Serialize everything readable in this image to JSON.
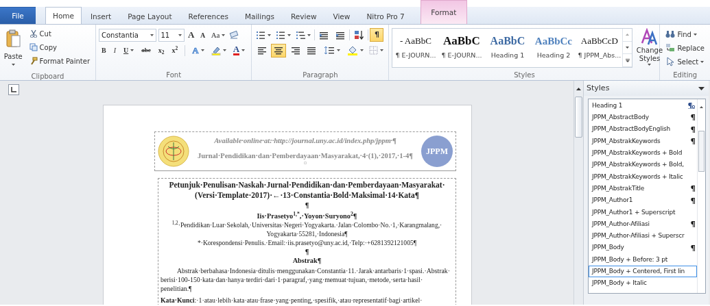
{
  "tabs": [
    {
      "label": "File",
      "kind": "file",
      "selected": false
    },
    {
      "label": "Home",
      "kind": "normal",
      "selected": true
    },
    {
      "label": "Insert",
      "kind": "normal",
      "selected": false
    },
    {
      "label": "Page Layout",
      "kind": "normal",
      "selected": false
    },
    {
      "label": "References",
      "kind": "normal",
      "selected": false
    },
    {
      "label": "Mailings",
      "kind": "normal",
      "selected": false
    },
    {
      "label": "Review",
      "kind": "normal",
      "selected": false
    },
    {
      "label": "View",
      "kind": "normal",
      "selected": false
    },
    {
      "label": "Nitro Pro 7",
      "kind": "normal",
      "selected": false
    },
    {
      "label": "Format",
      "kind": "contextual",
      "selected": false
    }
  ],
  "clipboard": {
    "paste": "Paste",
    "items": [
      {
        "label": "Cut",
        "kind": "cut"
      },
      {
        "label": "Copy",
        "kind": "copy"
      },
      {
        "label": "Format Painter",
        "kind": "painter"
      }
    ],
    "label": "Clipboard"
  },
  "font": {
    "name": "Constantia",
    "size": "11",
    "row1": [
      {
        "label": "A",
        "kind": "grow"
      },
      {
        "label": "A",
        "kind": "shrink"
      },
      {
        "label": "Aa",
        "kind": "case"
      }
    ],
    "row2": [
      {
        "label": "B",
        "kind": "bold"
      },
      {
        "label": "I",
        "kind": "italic"
      },
      {
        "label": "U",
        "kind": "underline"
      },
      {
        "label": "abe",
        "kind": "strike"
      },
      {
        "label": "x$_{2}$",
        "kind": "sub"
      },
      {
        "label": "x$^{2}$",
        "kind": "sup"
      },
      {
        "label": "A",
        "kind": "effects"
      },
      {
        "label": "A",
        "kind": "color"
      }
    ],
    "label": "Font"
  },
  "paragraph": {
    "show_marks": {
      "label": "¶",
      "selected": true
    },
    "align": [
      {
        "kind": "left",
        "selected": false
      },
      {
        "kind": "center",
        "selected": true
      },
      {
        "kind": "right",
        "selected": false
      },
      {
        "kind": "justify",
        "selected": false
      }
    ],
    "label": "Paragraph"
  },
  "styles_gallery": {
    "items": [
      {
        "preview": "- AaBbC",
        "name": "¶ E-JOURN...",
        "kind": "normal"
      },
      {
        "preview": "AaBbC",
        "name": "¶ E-JOURN...",
        "kind": "title"
      },
      {
        "preview": "AaBbC",
        "name": "Heading 1",
        "kind": "heading1"
      },
      {
        "preview": "AaBbCc",
        "name": "Heading 2",
        "kind": "heading2"
      },
      {
        "preview": "AaBbCcD",
        "name": "¶ JPPM_Abs...",
        "kind": "normal"
      }
    ],
    "change": "Change Styles",
    "label": "Styles"
  },
  "editing": {
    "items": [
      {
        "label": "Find",
        "kind": "find"
      },
      {
        "label": "Replace",
        "kind": "replace"
      },
      {
        "label": "Select",
        "kind": "select"
      }
    ],
    "label": "Editing"
  },
  "document": {
    "header_line_1": "Available·online·at:·http://journal.uny.ac.id/index.php/jppm·¶",
    "header_line_2": "Jurnal·Pendidikan·dan·Pemberdayaan·Masyarakat,·4·(1),·2017,·1-4¶",
    "header_end": "¤",
    "logo_text": "JPPM",
    "paragraphs": [
      {
        "kind": "title",
        "text": "Petunjuk·Penulisan·Naskah·Jurnal·Pendidikan·dan·Pemberdayaan·Masyarakat·(Versi·Template·2017)·←·13·Constantia·Bold·Maksimal·14·Kata¶"
      },
      {
        "kind": "empty",
        "text": "¶"
      },
      {
        "kind": "authors",
        "text": "Iis·Prasetyo$^{1,*}$,·Yoyon·Suryono$^{2}$¶"
      },
      {
        "kind": "center",
        "text": "$^{1,2}$·Pendidikan·Luar·Sekolah,·Universitas·Negeri·Yogyakarta.·Jalan·Colombo·No.·1,·Karangmalang,·Yogyakarta·55281,·Indonesia¶"
      },
      {
        "kind": "center",
        "text": "*·Korespondensi·Penulis.·Email:·iis.prasetyo@uny.ac.id,·Telp:·+6281392121005¶"
      },
      {
        "kind": "empty",
        "text": "¶"
      },
      {
        "kind": "heading",
        "text": "Abstrak¶"
      },
      {
        "kind": "body",
        "text": "Abstrak·berbahasa·Indonesia·ditulis·menggunakan·Constantia·11.·Jarak·antarbaris·1·spasi.·Abstrak·berisi·100-150·kata·dan·hanya·terdiri·dari·1·paragraf,·yang·memuat·tujuan,·metode,·serta·hasil·penelitian.¶"
      },
      {
        "kind": "keywords",
        "text": "**Kata·Kunci**:·1·atau·lebih·kata·atau·frase·yang·penting,·spesifik,·atau·representatif·bagi·artikel·"
      }
    ]
  },
  "styles_pane": {
    "title": "Styles",
    "items": [
      {
        "name": "Heading 1",
        "kind": "linked",
        "selected": false
      },
      {
        "name": "JPPM_AbstractBody",
        "kind": "paragraph",
        "selected": false
      },
      {
        "name": "JPPM_AbstractBodyEnglish",
        "kind": "paragraph",
        "selected": false
      },
      {
        "name": "JPPM_AbstrakKeywords",
        "kind": "paragraph",
        "selected": false
      },
      {
        "name": "JPPM_AbstrakKeywords + Bold",
        "kind": "plain",
        "selected": false
      },
      {
        "name": "JPPM_AbstrakKeywords + Bold,",
        "kind": "plain",
        "selected": false
      },
      {
        "name": "JPPM_AbstrakKeywords + Italic",
        "kind": "plain",
        "selected": false
      },
      {
        "name": "JPPM_AbstrakTitle",
        "kind": "paragraph",
        "selected": false
      },
      {
        "name": "JPPM_Author1",
        "kind": "paragraph",
        "selected": false
      },
      {
        "name": "JPPM_Author1 + Superscript",
        "kind": "plain",
        "selected": false
      },
      {
        "name": "JPPM_Author-Afiliasi",
        "kind": "paragraph",
        "selected": false
      },
      {
        "name": "JPPM_Author-Afiliasi + Superscr",
        "kind": "plain",
        "selected": false
      },
      {
        "name": "JPPM_Body",
        "kind": "paragraph",
        "selected": false
      },
      {
        "name": "JPPM_Body + Before:  3 pt",
        "kind": "plain",
        "selected": false
      },
      {
        "name": "JPPM_Body + Centered, First lin",
        "kind": "plain",
        "selected": true
      },
      {
        "name": "JPPM_Body + Italic",
        "kind": "plain",
        "selected": false
      }
    ]
  }
}
